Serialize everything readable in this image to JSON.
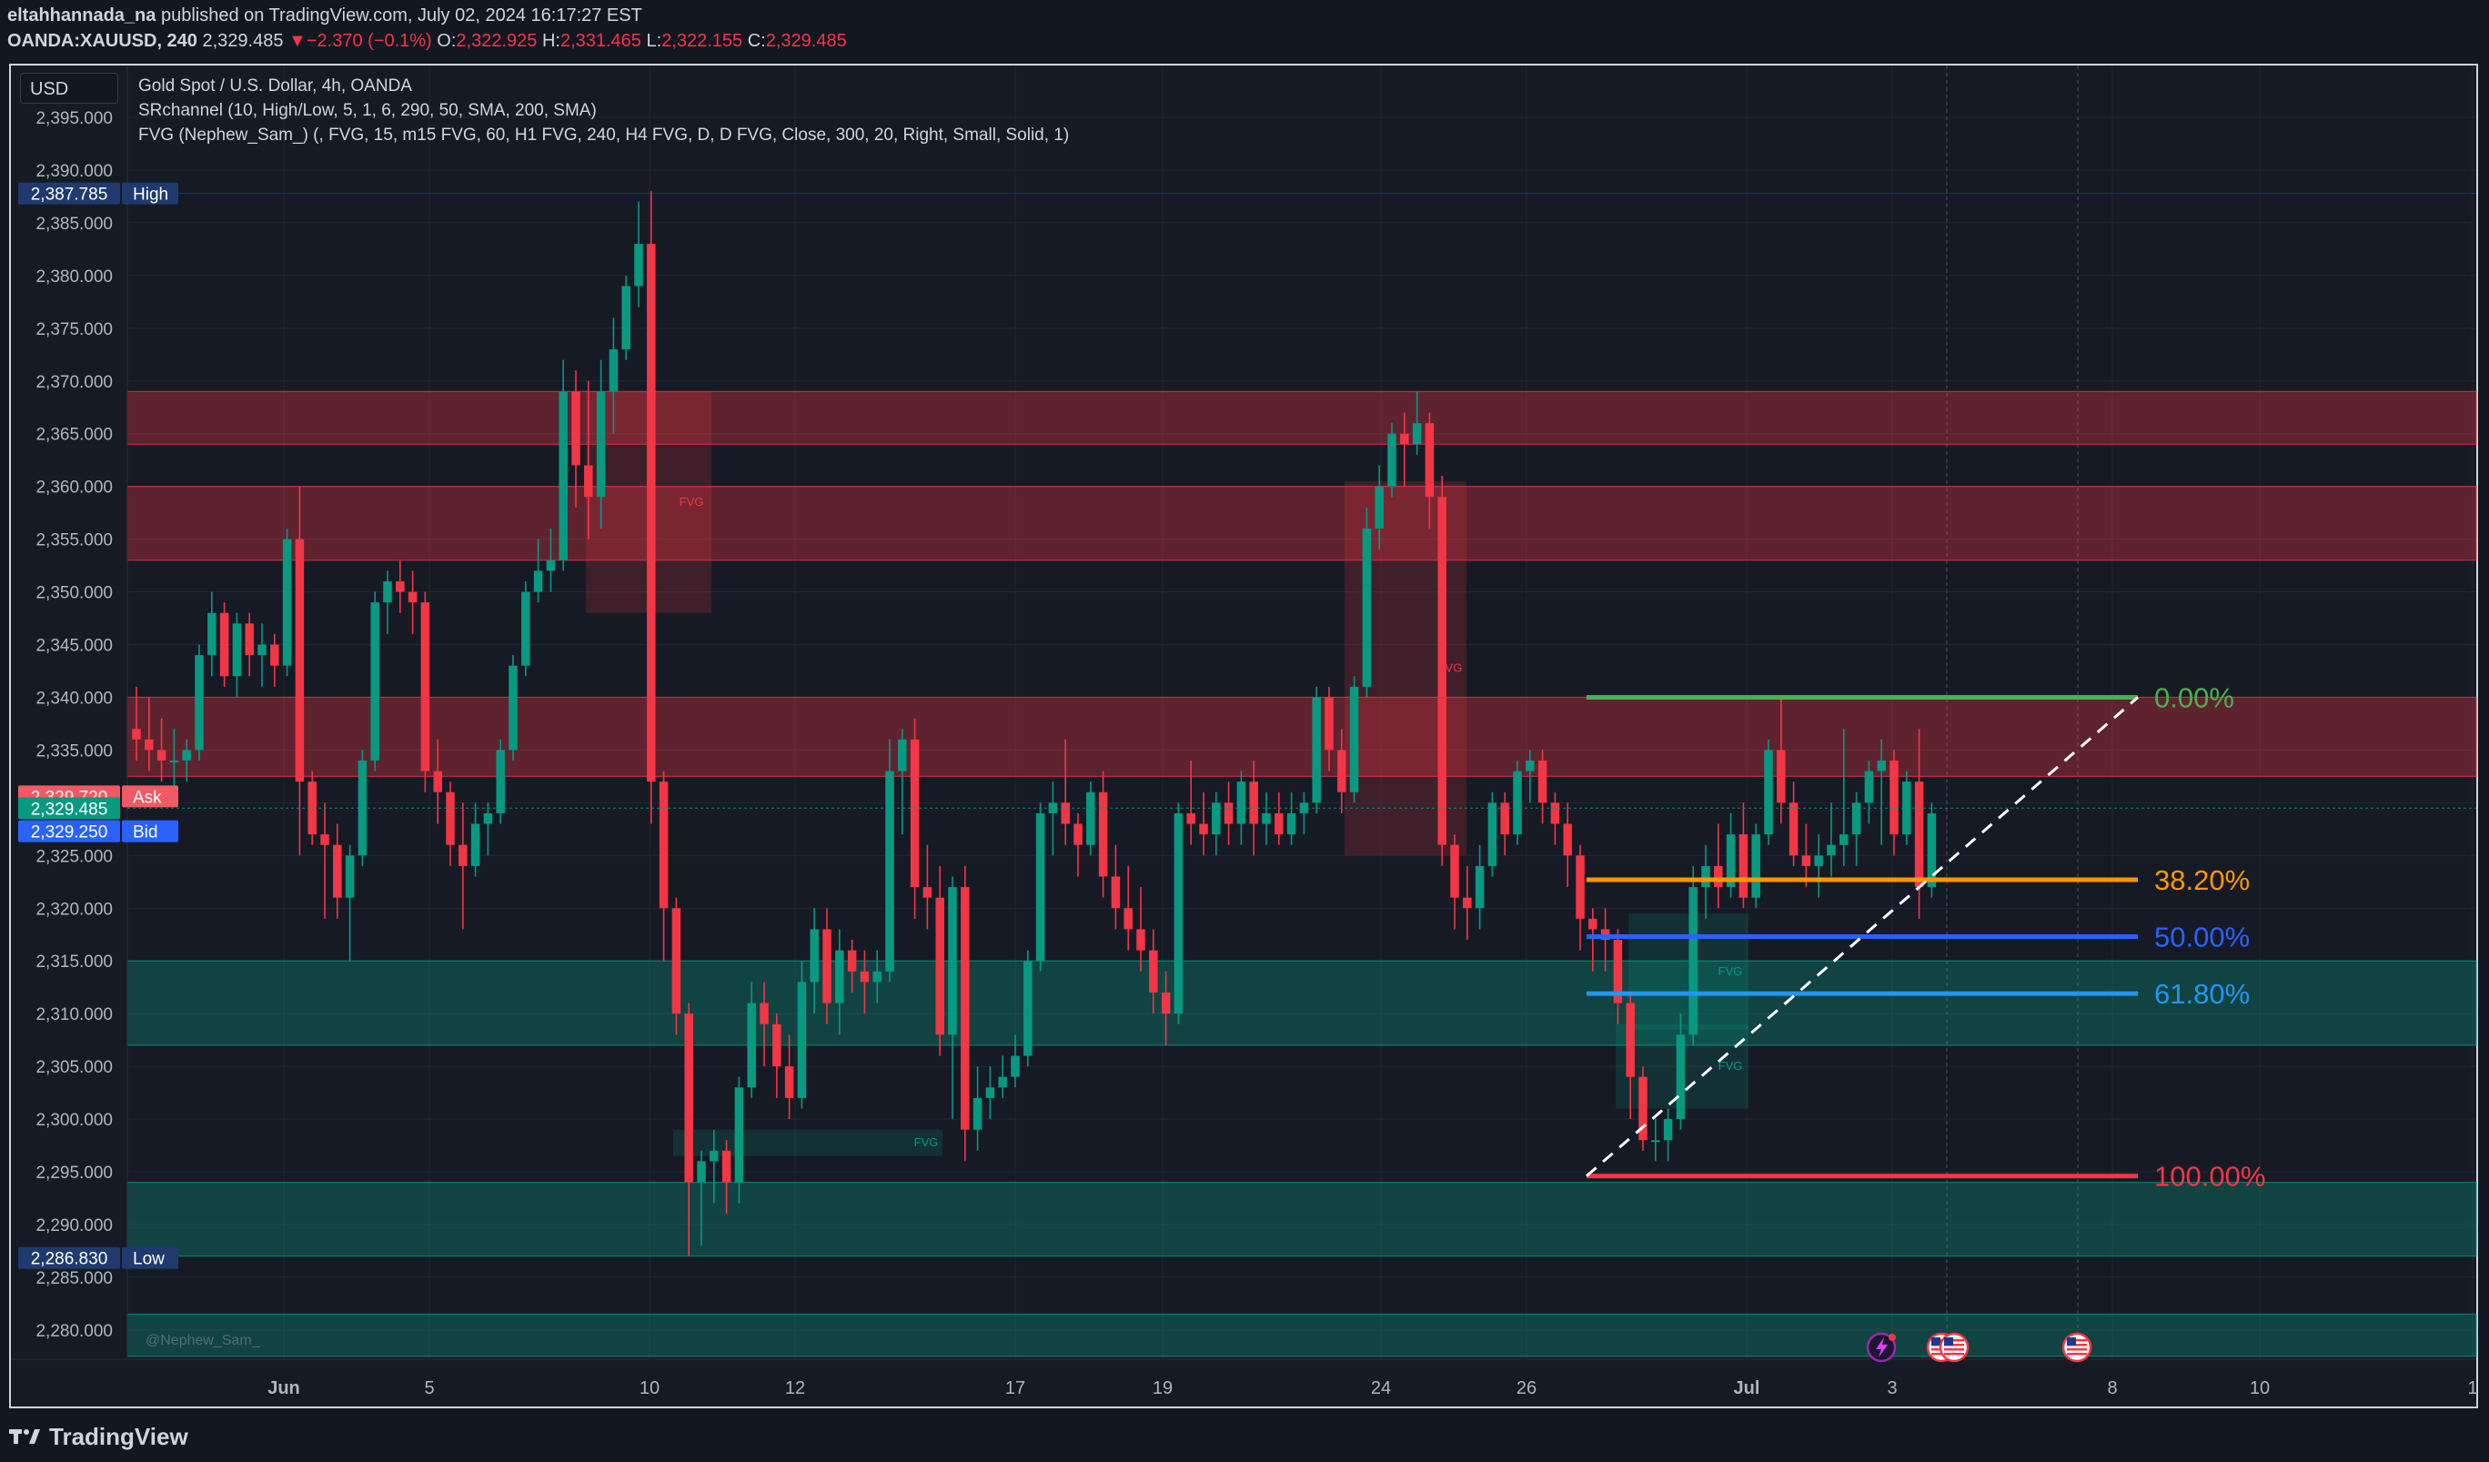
{
  "header": {
    "author": "eltahhannada_na",
    "published_text": "published on TradingView.com, July 02, 2024 16:17:27 EST",
    "symbol": "OANDA:XAUUSD, 240",
    "last": "2,329.485",
    "change": "−2.370 (−0.1%)",
    "o_label": "O:",
    "o": "2,322.925",
    "h_label": "H:",
    "h": "2,331.465",
    "l_label": "L:",
    "l": "2,322.155",
    "c_label": "C:",
    "c": "2,329.485"
  },
  "currency_button": "USD",
  "legend": {
    "title": "Gold Spot / U.S. Dollar, 4h, OANDA",
    "indicator1": "SRchannel (10, High/Low, 5, 1, 6, 290, 50, SMA, 200, SMA)",
    "indicator2": "FVG (Nephew_Sam_) (, FVG, 15, m15 FVG, 60, H1 FVG, 240, H4 FVG, D, D FVG, Close, 300, 20, Right, Small, Solid, 1)"
  },
  "price_tags": {
    "high_value": "2,387.785",
    "high_label": "High",
    "ask_value": "2,329.720",
    "ask_label": "Ask",
    "last_value": "2,329.485",
    "bid_value": "2,329.250",
    "bid_label": "Bid",
    "low_value": "2,286.830",
    "low_label": "Low"
  },
  "watermark": "@Nephew_Sam_",
  "brand": "TradingView",
  "colors": {
    "background": "#161a25",
    "up": "#089981",
    "down": "#f23645",
    "resistance_zone": "#f23645",
    "support_zone": "#089981",
    "fib_0": "#4caf50",
    "fib_382": "#ff9800",
    "fib_50": "#2962ff",
    "fib_618": "#2196f3",
    "fib_100": "#f23645"
  },
  "chart_data": {
    "type": "candlestick",
    "y_axis_labels": [
      "2,280.000",
      "2,285.000",
      "2,290.000",
      "2,295.000",
      "2,300.000",
      "2,305.000",
      "2,310.000",
      "2,315.000",
      "2,320.000",
      "2,325.000",
      "2,330.000",
      "2,335.000",
      "2,340.000",
      "2,345.000",
      "2,350.000",
      "2,355.000",
      "2,360.000",
      "2,365.000",
      "2,370.000",
      "2,375.000",
      "2,380.000",
      "2,385.000",
      "2,390.000",
      "2,395.000"
    ],
    "x_axis_labels": [
      "Jun",
      "5",
      "10",
      "12",
      "17",
      "19",
      "24",
      "26",
      "Jul",
      "3",
      "8",
      "10",
      "1"
    ],
    "ylim": [
      2276.5,
      2397
    ],
    "candles_ohlc": [
      [
        2337,
        2341,
        2334,
        2336
      ],
      [
        2336,
        2340,
        2333,
        2335
      ],
      [
        2335,
        2338,
        2332,
        2334
      ],
      [
        2334,
        2337,
        2331,
        2334
      ],
      [
        2334,
        2336,
        2332,
        2335
      ],
      [
        2335,
        2345,
        2334,
        2344
      ],
      [
        2344,
        2350,
        2342,
        2348
      ],
      [
        2348,
        2349,
        2341,
        2342
      ],
      [
        2342,
        2348,
        2340,
        2347
      ],
      [
        2347,
        2348,
        2342,
        2344
      ],
      [
        2344,
        2347,
        2341,
        2345
      ],
      [
        2345,
        2346,
        2341,
        2343
      ],
      [
        2343,
        2356,
        2342,
        2355
      ],
      [
        2355,
        2360,
        2325,
        2332
      ],
      [
        2332,
        2333,
        2326,
        2327
      ],
      [
        2327,
        2330,
        2319,
        2326
      ],
      [
        2326,
        2328,
        2319,
        2321
      ],
      [
        2321,
        2326,
        2315,
        2325
      ],
      [
        2325,
        2335,
        2324,
        2334
      ],
      [
        2334,
        2350,
        2333,
        2349
      ],
      [
        2349,
        2352,
        2346,
        2351
      ],
      [
        2351,
        2353,
        2348,
        2350
      ],
      [
        2350,
        2352,
        2346,
        2349
      ],
      [
        2349,
        2350,
        2331,
        2333
      ],
      [
        2333,
        2336,
        2328,
        2331
      ],
      [
        2331,
        2332,
        2324,
        2326
      ],
      [
        2326,
        2330,
        2318,
        2324
      ],
      [
        2324,
        2330,
        2323,
        2328
      ],
      [
        2328,
        2330,
        2325,
        2329
      ],
      [
        2329,
        2336,
        2328,
        2335
      ],
      [
        2335,
        2344,
        2334,
        2343
      ],
      [
        2343,
        2351,
        2342,
        2350
      ],
      [
        2350,
        2355,
        2349,
        2352
      ],
      [
        2352,
        2356,
        2350,
        2353
      ],
      [
        2353,
        2372,
        2352,
        2369
      ],
      [
        2369,
        2371,
        2358,
        2362
      ],
      [
        2362,
        2370,
        2355,
        2359
      ],
      [
        2359,
        2372,
        2356,
        2369
      ],
      [
        2369,
        2376,
        2365,
        2373
      ],
      [
        2373,
        2380,
        2372,
        2379
      ],
      [
        2379,
        2387,
        2377,
        2383
      ],
      [
        2383,
        2388,
        2328,
        2332
      ],
      [
        2332,
        2333,
        2315,
        2320
      ],
      [
        2320,
        2321,
        2308,
        2310
      ],
      [
        2310,
        2311,
        2287,
        2294
      ],
      [
        2294,
        2297,
        2288,
        2296
      ],
      [
        2296,
        2299,
        2292,
        2297
      ],
      [
        2297,
        2298,
        2291,
        2294
      ],
      [
        2294,
        2304,
        2292,
        2303
      ],
      [
        2303,
        2313,
        2302,
        2311
      ],
      [
        2311,
        2313,
        2305,
        2309
      ],
      [
        2309,
        2310,
        2302,
        2305
      ],
      [
        2305,
        2308,
        2300,
        2302
      ],
      [
        2302,
        2315,
        2301,
        2313
      ],
      [
        2313,
        2320,
        2310,
        2318
      ],
      [
        2318,
        2320,
        2309,
        2311
      ],
      [
        2311,
        2318,
        2308,
        2316
      ],
      [
        2316,
        2317,
        2312,
        2314
      ],
      [
        2314,
        2316,
        2310,
        2313
      ],
      [
        2313,
        2316,
        2311,
        2314
      ],
      [
        2314,
        2336,
        2313,
        2333
      ],
      [
        2333,
        2337,
        2327,
        2336
      ],
      [
        2336,
        2338,
        2319,
        2322
      ],
      [
        2322,
        2326,
        2318,
        2321
      ],
      [
        2321,
        2324,
        2306,
        2308
      ],
      [
        2308,
        2323,
        2300,
        2322
      ],
      [
        2322,
        2324,
        2296,
        2299
      ],
      [
        2299,
        2305,
        2297,
        2302
      ],
      [
        2302,
        2305,
        2300,
        2303
      ],
      [
        2303,
        2306,
        2302,
        2304
      ],
      [
        2304,
        2308,
        2303,
        2306
      ],
      [
        2306,
        2316,
        2305,
        2315
      ],
      [
        2315,
        2330,
        2314,
        2329
      ],
      [
        2329,
        2332,
        2325,
        2330
      ],
      [
        2330,
        2336,
        2326,
        2328
      ],
      [
        2328,
        2329,
        2323,
        2326
      ],
      [
        2326,
        2332,
        2325,
        2331
      ],
      [
        2331,
        2333,
        2321,
        2323
      ],
      [
        2323,
        2326,
        2318,
        2320
      ],
      [
        2320,
        2324,
        2316,
        2318
      ],
      [
        2318,
        2322,
        2314,
        2316
      ],
      [
        2316,
        2318,
        2310,
        2312
      ],
      [
        2312,
        2314,
        2307,
        2310
      ],
      [
        2310,
        2330,
        2309,
        2329
      ],
      [
        2329,
        2334,
        2326,
        2328
      ],
      [
        2328,
        2331,
        2325,
        2327
      ],
      [
        2327,
        2331,
        2325,
        2330
      ],
      [
        2330,
        2332,
        2326,
        2328
      ],
      [
        2328,
        2333,
        2326,
        2332
      ],
      [
        2332,
        2334,
        2325,
        2328
      ],
      [
        2328,
        2331,
        2326,
        2329
      ],
      [
        2329,
        2331,
        2326,
        2327
      ],
      [
        2327,
        2331,
        2326,
        2329
      ],
      [
        2329,
        2331,
        2327,
        2330
      ],
      [
        2330,
        2341,
        2329,
        2340
      ],
      [
        2340,
        2341,
        2333,
        2335
      ],
      [
        2335,
        2337,
        2329,
        2331
      ],
      [
        2331,
        2342,
        2330,
        2341
      ],
      [
        2341,
        2358,
        2340,
        2356
      ],
      [
        2356,
        2362,
        2354,
        2360
      ],
      [
        2360,
        2366,
        2359,
        2365
      ],
      [
        2365,
        2367,
        2360,
        2364
      ],
      [
        2364,
        2369,
        2363,
        2366
      ],
      [
        2366,
        2367,
        2356,
        2359
      ],
      [
        2359,
        2361,
        2324,
        2326
      ],
      [
        2326,
        2327,
        2318,
        2321
      ],
      [
        2321,
        2324,
        2317,
        2320
      ],
      [
        2320,
        2326,
        2318,
        2324
      ],
      [
        2324,
        2331,
        2323,
        2330
      ],
      [
        2330,
        2331,
        2325,
        2327
      ],
      [
        2327,
        2334,
        2326,
        2333
      ],
      [
        2333,
        2335,
        2330,
        2334
      ],
      [
        2334,
        2335,
        2328,
        2330
      ],
      [
        2330,
        2331,
        2326,
        2328
      ],
      [
        2328,
        2330,
        2322,
        2325
      ],
      [
        2325,
        2326,
        2316,
        2319
      ],
      [
        2319,
        2320,
        2314,
        2318
      ],
      [
        2318,
        2320,
        2314,
        2317
      ],
      [
        2317,
        2318,
        2309,
        2311
      ],
      [
        2311,
        2312,
        2300,
        2304
      ],
      [
        2304,
        2305,
        2297,
        2298
      ],
      [
        2298,
        2300,
        2296,
        2298
      ],
      [
        2298,
        2301,
        2296,
        2300
      ],
      [
        2300,
        2310,
        2299,
        2308
      ],
      [
        2308,
        2324,
        2307,
        2322
      ],
      [
        2322,
        2326,
        2319,
        2324
      ],
      [
        2324,
        2328,
        2320,
        2322
      ],
      [
        2322,
        2329,
        2321,
        2327
      ],
      [
        2327,
        2330,
        2320,
        2321
      ],
      [
        2321,
        2328,
        2320,
        2327
      ],
      [
        2327,
        2336,
        2326,
        2335
      ],
      [
        2335,
        2340,
        2328,
        2330
      ],
      [
        2330,
        2332,
        2324,
        2325
      ],
      [
        2325,
        2328,
        2322,
        2324
      ],
      [
        2324,
        2327,
        2321,
        2325
      ],
      [
        2325,
        2330,
        2323,
        2326
      ],
      [
        2326,
        2337,
        2324,
        2327
      ],
      [
        2327,
        2331,
        2324,
        2330
      ],
      [
        2330,
        2334,
        2328,
        2333
      ],
      [
        2333,
        2336,
        2326,
        2334
      ],
      [
        2334,
        2335,
        2325,
        2327
      ],
      [
        2327,
        2333,
        2326,
        2332
      ],
      [
        2332,
        2337,
        2319,
        2322
      ],
      [
        2322,
        2330,
        2321,
        2329
      ]
    ],
    "sr_zones": [
      {
        "type": "resistance",
        "top": 2369,
        "bottom": 2364
      },
      {
        "type": "resistance",
        "top": 2360,
        "bottom": 2353
      },
      {
        "type": "resistance",
        "top": 2340,
        "bottom": 2332.5
      },
      {
        "type": "support",
        "top": 2315,
        "bottom": 2307
      },
      {
        "type": "support",
        "top": 2294,
        "bottom": 2287
      },
      {
        "type": "support",
        "top": 2281.5,
        "bottom": 2277.5
      }
    ],
    "fvg_boxes": [
      {
        "type": "bearish",
        "label": "FVG",
        "top": 2369,
        "bottom": 2348
      },
      {
        "type": "bearish",
        "label": "FVG",
        "top": 2360.5,
        "bottom": 2325
      },
      {
        "type": "bullish",
        "label": "FVG",
        "top": 2299,
        "bottom": 2296.5
      },
      {
        "type": "bullish",
        "label": "FVG",
        "top": 2319.5,
        "bottom": 2308.5
      },
      {
        "type": "bullish",
        "label": "FVG",
        "top": 2309,
        "bottom": 2301
      }
    ],
    "fibonacci": {
      "levels": [
        {
          "label": "0.00%",
          "price": 2340.0
        },
        {
          "label": "38.20%",
          "price": 2322.7
        },
        {
          "label": "50.00%",
          "price": 2317.3
        },
        {
          "label": "61.80%",
          "price": 2311.9
        },
        {
          "label": "100.00%",
          "price": 2294.6
        }
      ],
      "trendline": {
        "from": 2294.6,
        "to": 2340.0
      }
    },
    "price_lines": {
      "last": 2329.485,
      "bid": 2329.25,
      "ask": 2329.72,
      "high": 2387.785,
      "low": 2286.83
    }
  }
}
